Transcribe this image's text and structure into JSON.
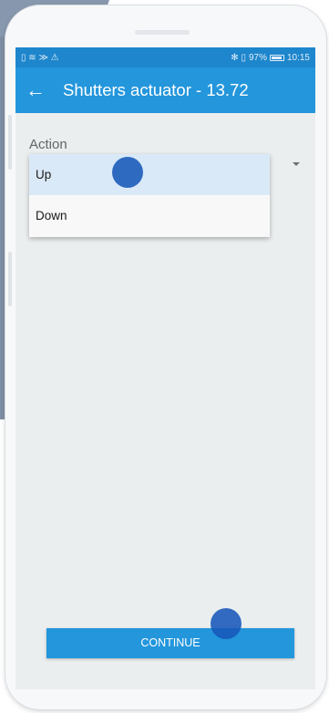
{
  "status_bar": {
    "left_icons": [
      "sim-icon",
      "wifi-icon",
      "nfc-icon",
      "warning-icon"
    ],
    "left_glyphs": "▯ ≋ ≫ ⚠",
    "right_glyphs": "✻ ▯",
    "battery_percent": "97%",
    "time": "10:15"
  },
  "app_bar": {
    "back_glyph": "←",
    "title": "Shutters actuator - 13.72"
  },
  "form": {
    "label": "Action",
    "options": [
      {
        "label": "Up",
        "selected": true
      },
      {
        "label": "Down",
        "selected": false
      }
    ]
  },
  "footer": {
    "continue_label": "CONTINUE"
  },
  "colors": {
    "primary": "#2396dc",
    "status_bar": "#1e86cc",
    "selected_item": "#d9e9f7",
    "touch_indicator": "#1758b9"
  }
}
